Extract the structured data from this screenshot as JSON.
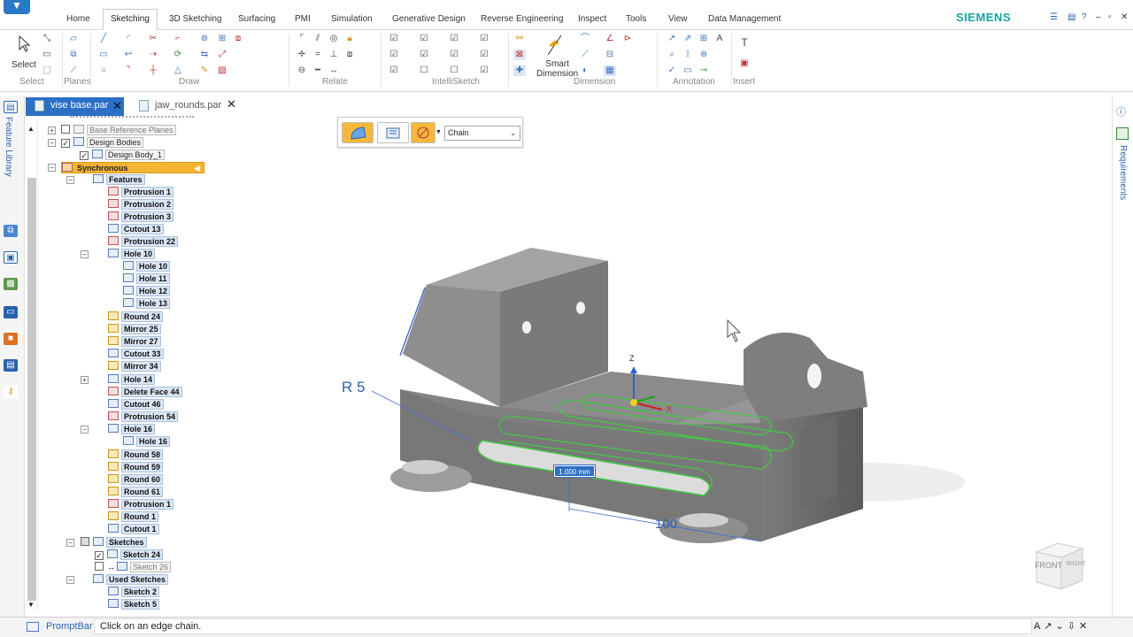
{
  "tabs": [
    "Home",
    "Sketching",
    "3D Sketching",
    "Surfacing",
    "PMI",
    "Simulation",
    "Generative Design",
    "Reverse Engineering",
    "Inspect",
    "Tools",
    "View",
    "Data Management"
  ],
  "active_tab": "Sketching",
  "brand": "SIEMENS",
  "ribbon": {
    "select_label": "Select",
    "groups": [
      "Select",
      "Planes",
      "Draw",
      "Relate",
      "IntelliSketch",
      "Dimension",
      "Annotation",
      "Insert"
    ],
    "smart_dimension": "Smart\nDimension"
  },
  "documents": [
    {
      "name": "vise base.par",
      "active": true
    },
    {
      "name": "jaw_rounds.par",
      "active": false
    }
  ],
  "side_labels": {
    "left": "Feature Library",
    "right": "Requirements"
  },
  "tree": {
    "base_reference_planes": "Base Reference Planes",
    "design_bodies": "Design Bodies",
    "design_body_1": "Design Body_1",
    "synchronous": "Synchronous",
    "features": "Features",
    "feature_items": [
      "Protrusion 1",
      "Protrusion 2",
      "Protrusion 3",
      "Cutout 13",
      "Protrusion 22",
      "Hole 10"
    ],
    "hole10_children": [
      "Hole 10",
      "Hole 11",
      "Hole 12",
      "Hole 13"
    ],
    "feature_items_2": [
      "Round 24",
      "Mirror 25",
      "Mirror 27",
      "Cutout 33",
      "Mirror 34",
      "Hole 14",
      "Delete Face 44",
      "Cutout 46",
      "Protrusion 54",
      "Hole 16"
    ],
    "hole16_children": [
      "Hole 16"
    ],
    "feature_items_3": [
      "Round 58",
      "Round 59",
      "Round 60",
      "Round 61",
      "Protrusion 1",
      "Round 1",
      "Cutout 1"
    ],
    "sketches": "Sketches",
    "sketch_items": [
      "Sketch 24",
      "Sketch 26"
    ],
    "used_sketches": "Used Sketches",
    "used_sketch_items": [
      "Sketch 2",
      "Sketch 5"
    ]
  },
  "quickbar": {
    "select_mode": "Chain"
  },
  "viewport": {
    "radius_label": "R 5",
    "dimension_value": "1.000 mm",
    "length_label": "100",
    "axis_z": "Z",
    "axis_x": "X"
  },
  "viewcube": {
    "front": "FRONT",
    "right": "RIGHT"
  },
  "promptbar": {
    "label": "PromptBar",
    "message": "Click on an edge chain."
  },
  "colors": {
    "accent": "#2c6fc6",
    "brand": "#1aa3a3",
    "highlight": "#3ec23e",
    "synchronous": "#f3b533"
  }
}
